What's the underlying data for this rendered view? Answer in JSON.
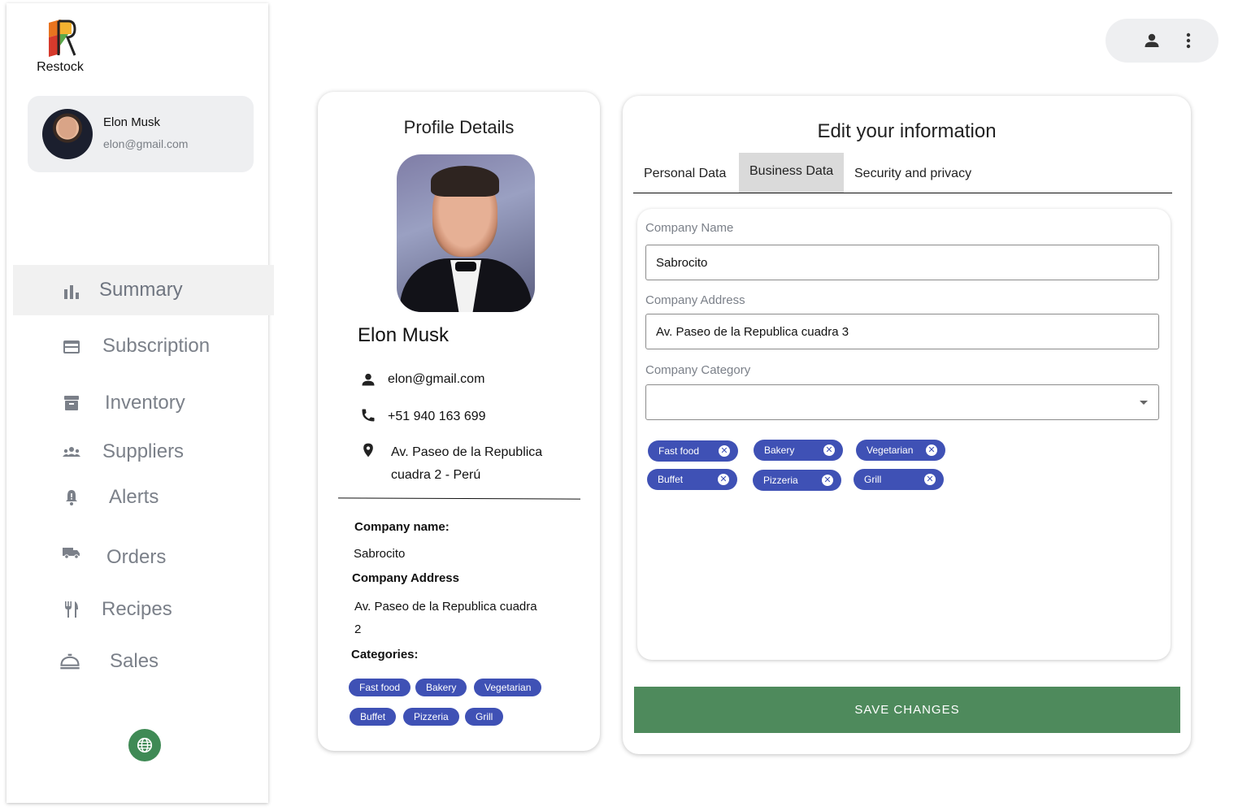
{
  "app": {
    "logo_text": "Restock"
  },
  "sidebar": {
    "user": {
      "name": "Elon Musk",
      "email": "elon@gmail.com"
    },
    "items": [
      {
        "label": "Summary",
        "icon": "bar-chart-icon"
      },
      {
        "label": "Subscription",
        "icon": "credit-card-icon"
      },
      {
        "label": "Inventory",
        "icon": "archive-icon"
      },
      {
        "label": "Suppliers",
        "icon": "groups-icon"
      },
      {
        "label": "Alerts",
        "icon": "bell-alert-icon"
      },
      {
        "label": "Orders",
        "icon": "truck-icon"
      },
      {
        "label": "Recipes",
        "icon": "restaurant-icon"
      },
      {
        "label": "Sales",
        "icon": "room-service-icon"
      }
    ],
    "active_index": 0,
    "globe_icon": "globe-icon",
    "accent": "#3f8a55"
  },
  "topbar": {
    "icons": [
      "person-icon",
      "more-vert-icon"
    ]
  },
  "profile": {
    "title": "Profile Details",
    "name": "Elon Musk",
    "email": "elon@gmail.com",
    "phone": "+51 940 163 699",
    "address_line1": "Av. Paseo de la Republica",
    "address_line2": "cuadra 2 - Perú",
    "company_name_label": "Company name:",
    "company_name": "Sabrocito",
    "company_address_label": "Company Address",
    "company_address_line1": "Av. Paseo de la Republica cuadra",
    "company_address_line2": "2",
    "categories_label": "Categories:",
    "categories": [
      "Fast food",
      "Bakery",
      "Vegetarian",
      "Buffet",
      "Pizzeria",
      "Grill"
    ]
  },
  "edit": {
    "title": "Edit your information",
    "tabs": [
      "Personal Data",
      "Business Data",
      "Security and privacy"
    ],
    "active_tab": 1,
    "company_name_label": "Company Name",
    "company_name_value": "Sabrocito",
    "company_address_label": "Company Address",
    "company_address_value": "Av. Paseo de la Republica cuadra 3",
    "company_category_label": "Company Category",
    "company_category_value": "",
    "chips": [
      "Fast food",
      "Bakery",
      "Vegetarian",
      "Buffet",
      "Pizzeria",
      "Grill"
    ],
    "save_label": "SAVE CHANGES",
    "chip_color": "#3f51b5",
    "save_color": "#4e8a5c"
  }
}
